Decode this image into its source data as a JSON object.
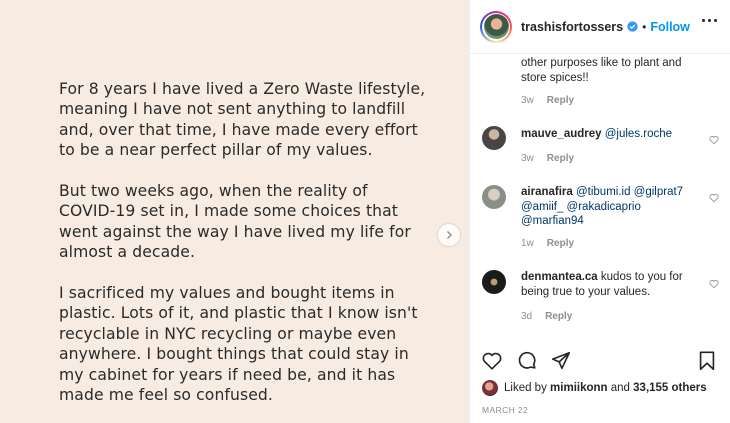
{
  "post": {
    "paragraphs": [
      "For 8 years I have lived a Zero Waste lifestyle,\nmeaning I have not sent anything to landfill\nand, over that time, I have made every effort\nto be a near perfect pillar of my values.",
      "But two weeks ago, when the reality of\nCOVID-19 set in, I made some choices that\nwent against the way I have lived my life for\nalmost a decade.",
      "I sacrificed my values and bought items in\nplastic. Lots of it, and plastic that I know isn't\nrecyclable in NYC recycling or maybe even\nanywhere. I bought things that could stay in\nmy cabinet for years if need be, and it has\nmade me feel so confused."
    ]
  },
  "header": {
    "username": "trashisfortossers",
    "separator": "•",
    "follow_label": "Follow"
  },
  "comments": [
    {
      "user": "",
      "text_lines": [
        "other purposes like to plant and",
        "store spices!!"
      ],
      "time": "3w",
      "reply_label": "Reply"
    },
    {
      "user": "mauve_audrey",
      "mentions": "@jules.roche",
      "time": "3w",
      "reply_label": "Reply"
    },
    {
      "user": "airanafira",
      "mentions_lines": [
        "@tibumi.id @gilprat7",
        "@amiif_ @rakadicaprio",
        "@marfian94"
      ],
      "time": "1w",
      "reply_label": "Reply"
    },
    {
      "user": "denmantea.ca",
      "text_lines": [
        "kudos to you for",
        "being true to your values."
      ],
      "time": "3d",
      "reply_label": "Reply"
    }
  ],
  "likes": {
    "prefix": "Liked by",
    "user": "mimiikonn",
    "conjunction": "and",
    "others": "33,155 others"
  },
  "date": "MARCH 22",
  "colors": {
    "post_background": "#f8ece2",
    "follow_blue": "#0095f6",
    "verified_blue": "#3897f0",
    "mention_blue": "#00376b",
    "meta_gray": "#8e8e8e"
  },
  "icons": [
    "chevron-right-icon",
    "verified-badge-icon",
    "more-options-icon",
    "heart-icon",
    "comment-icon",
    "share-icon",
    "bookmark-icon"
  ]
}
